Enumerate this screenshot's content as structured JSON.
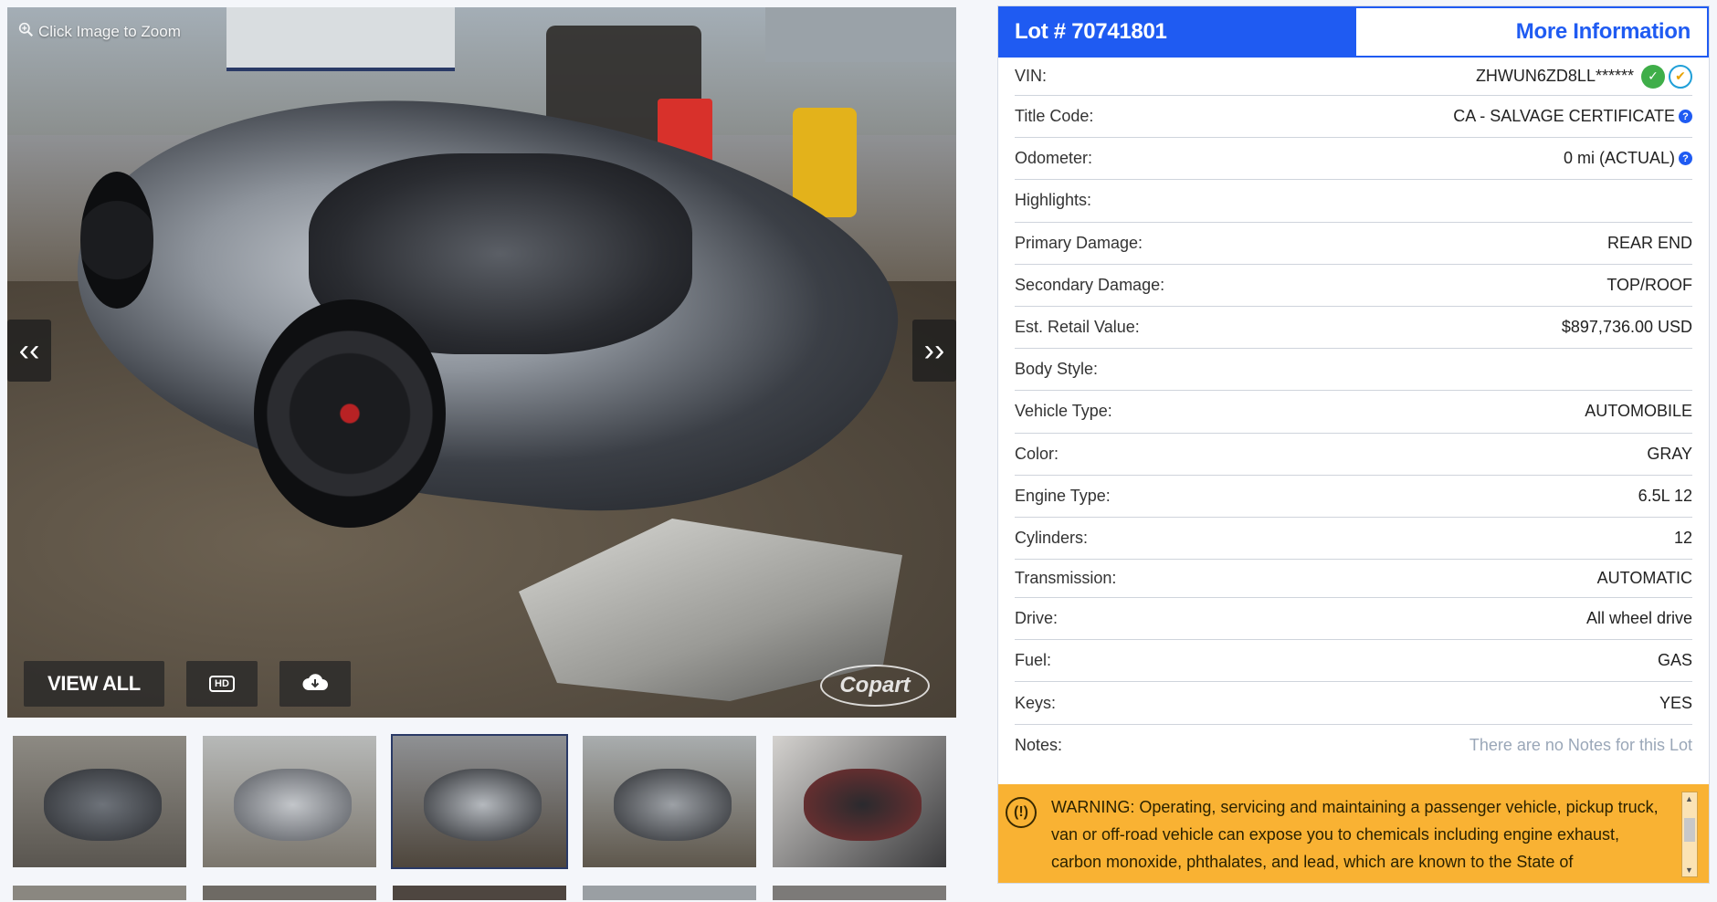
{
  "gallery": {
    "zoom_hint": "Click Image to Zoom",
    "view_all_label": "VIEW ALL",
    "hd_label": "HD",
    "watermark": "Copart",
    "thumbnail_count": 5
  },
  "details": {
    "lot_title": "Lot # 70741801",
    "more_info_label": "More Information",
    "rows": [
      {
        "label": "VIN:",
        "value": "ZHWUN6ZD8LL******"
      },
      {
        "label": "Title Code:",
        "value": "CA - SALVAGE CERTIFICATE"
      },
      {
        "label": "Odometer:",
        "value": "0 mi (ACTUAL)"
      },
      {
        "label": "Highlights:",
        "value": ""
      },
      {
        "label": "Primary Damage:",
        "value": "REAR END"
      },
      {
        "label": "Secondary Damage:",
        "value": "TOP/ROOF"
      },
      {
        "label": "Est. Retail Value:",
        "value": "$897,736.00 USD"
      },
      {
        "label": "Body Style:",
        "value": ""
      },
      {
        "label": "Vehicle Type:",
        "value": "AUTOMOBILE"
      },
      {
        "label": "Color:",
        "value": "GRAY"
      },
      {
        "label": "Engine Type:",
        "value": "6.5L 12"
      },
      {
        "label": "Cylinders:",
        "value": "12"
      },
      {
        "label": "Transmission:",
        "value": "AUTOMATIC"
      },
      {
        "label": "Drive:",
        "value": "All wheel drive"
      },
      {
        "label": "Fuel:",
        "value": "GAS"
      },
      {
        "label": "Keys:",
        "value": "YES"
      },
      {
        "label": "Notes:",
        "value": "There are no Notes for this Lot"
      }
    ],
    "warning_text": "WARNING: Operating, servicing and maintaining a passenger vehicle, pickup truck, van or off-road vehicle can expose you to chemicals including engine exhaust, carbon monoxide, phthalates, and lead, which are known to the State of"
  },
  "colors": {
    "brand_blue": "#1f5bf2",
    "warning_bg": "#f9b233",
    "vin_check_green": "#3fae49"
  }
}
